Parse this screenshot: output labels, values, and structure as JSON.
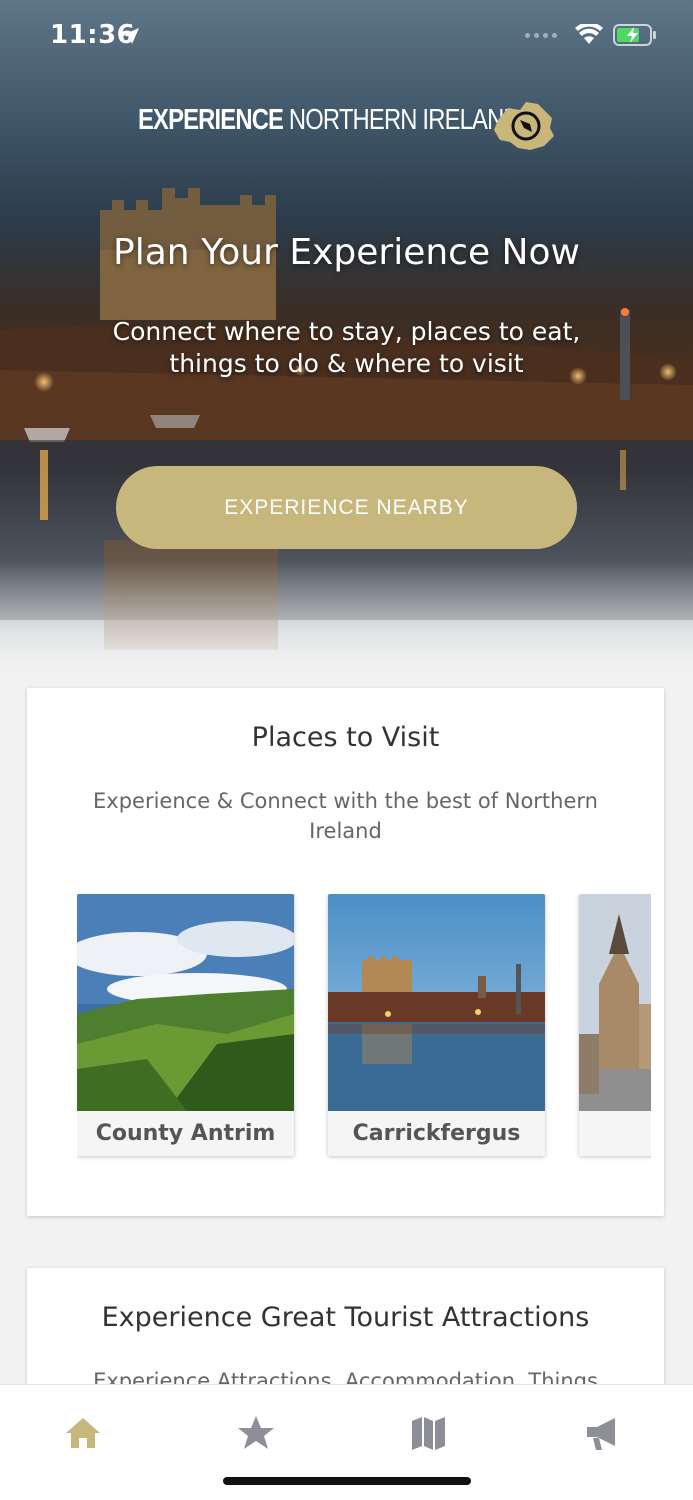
{
  "status_bar": {
    "time": "11:36"
  },
  "logo": {
    "bold": "EXPERIENCE",
    "light": " NORTHERN IRELAND"
  },
  "hero": {
    "title": "Plan Your Experience Now",
    "subtitle": "Connect where to stay, places to eat, things to do & where to visit",
    "button_label": "EXPERIENCE NEARBY"
  },
  "places_card": {
    "title": "Places to Visit",
    "subtitle": "Experience & Connect with the best of Northern Ireland",
    "items": [
      {
        "label": "County Antrim"
      },
      {
        "label": "Carrickfergus"
      },
      {
        "label": ""
      }
    ]
  },
  "attractions_card": {
    "title": "Experience Great Tourist Attractions",
    "subtitle": "Experience Attractions, Accommodation, Things"
  },
  "tabbar": {
    "tabs": [
      {
        "icon": "home-icon",
        "active": true
      },
      {
        "icon": "star-icon",
        "active": false
      },
      {
        "icon": "map-icon",
        "active": false
      },
      {
        "icon": "megaphone-icon",
        "active": false
      }
    ]
  },
  "colors": {
    "accent": "#c8b77d",
    "inactive_icon": "#8e8e98"
  }
}
